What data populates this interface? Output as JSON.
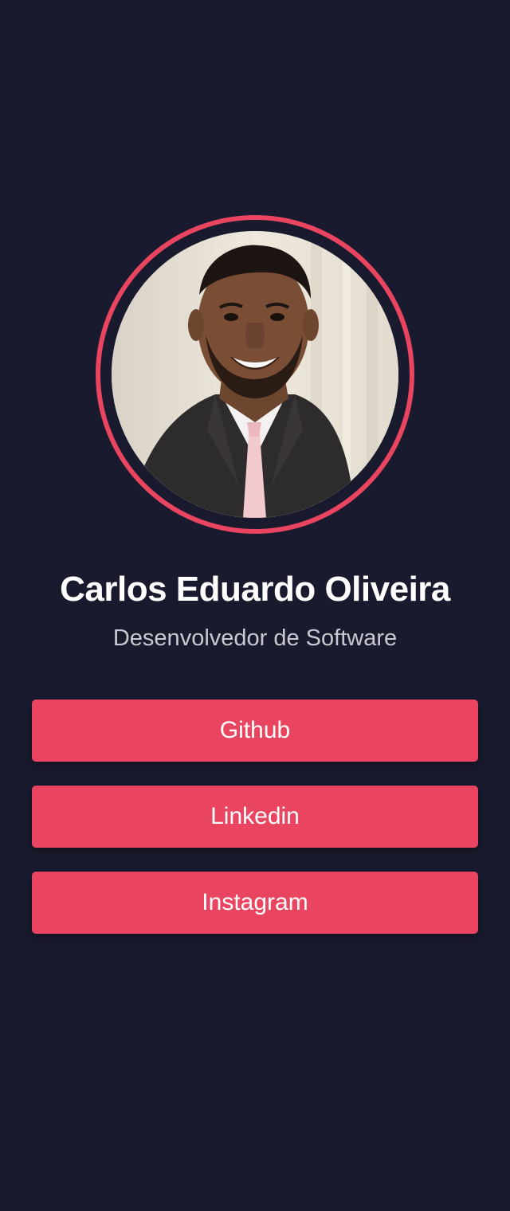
{
  "profile": {
    "name": "Carlos Eduardo Oliveira",
    "role": "Desenvolvedor de Software",
    "avatar_icon": "profile-photo"
  },
  "links": [
    {
      "label": "Github"
    },
    {
      "label": "Linkedin"
    },
    {
      "label": "Instagram"
    }
  ],
  "colors": {
    "background": "#1a1a2e",
    "accent": "#e94560",
    "text": "#ffffff",
    "subtext": "#c9c9d1"
  }
}
